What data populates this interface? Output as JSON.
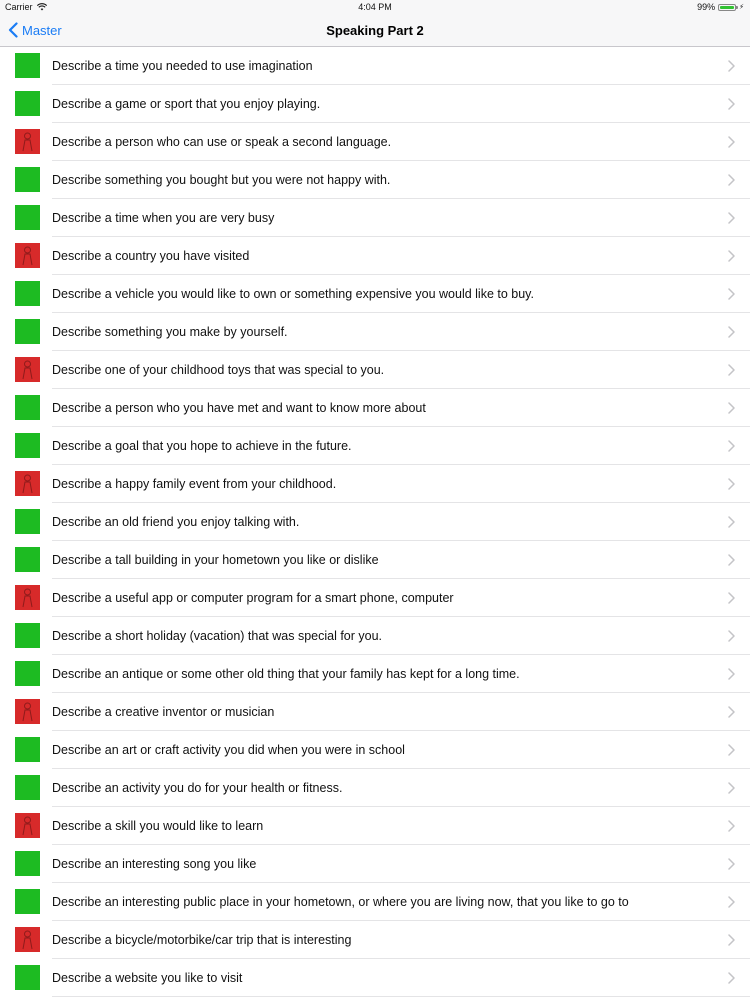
{
  "status_bar": {
    "carrier": "Carrier",
    "time": "4:04 PM",
    "battery_percent": "99%",
    "battery_level": 0.99,
    "battery_color": "#31c232"
  },
  "nav": {
    "back_label": "Master",
    "title": "Speaking Part 2",
    "tint_color": "#1a7cf5"
  },
  "topics": [
    {
      "label": "Describe a time you needed to use imagination",
      "thumb_color": "green"
    },
    {
      "label": "Describe a game or sport that you enjoy playing.",
      "thumb_color": "green"
    },
    {
      "label": "Describe a person who can use or speak a second language.",
      "thumb_color": "red"
    },
    {
      "label": "Describe something you bought but you were not happy with.",
      "thumb_color": "green"
    },
    {
      "label": "Describe a time when you are very busy",
      "thumb_color": "green"
    },
    {
      "label": "Describe a country you have visited",
      "thumb_color": "red"
    },
    {
      "label": "Describe a vehicle you would like to own or something expensive you would like to buy.",
      "thumb_color": "green"
    },
    {
      "label": "Describe something you make by yourself.",
      "thumb_color": "green"
    },
    {
      "label": "Describe one of your childhood toys that was special to you.",
      "thumb_color": "red"
    },
    {
      "label": "Describe a person who you have met and want to know more about",
      "thumb_color": "green"
    },
    {
      "label": "Describe a goal that you hope to achieve in the future.",
      "thumb_color": "green"
    },
    {
      "label": "Describe a happy family event from your childhood.",
      "thumb_color": "red"
    },
    {
      "label": "Describe an old friend you enjoy talking with.",
      "thumb_color": "green"
    },
    {
      "label": "Describe a tall building in your hometown you like or dislike",
      "thumb_color": "green"
    },
    {
      "label": "Describe a useful app or computer program for a smart phone, computer",
      "thumb_color": "red"
    },
    {
      "label": "Describe a short holiday (vacation) that was special for you.",
      "thumb_color": "green"
    },
    {
      "label": "Describe an antique or some other old thing that your family has kept for a long time.",
      "thumb_color": "green"
    },
    {
      "label": "Describe a creative inventor or musician",
      "thumb_color": "red"
    },
    {
      "label": "Describe an art or craft activity you did when you were in school",
      "thumb_color": "green"
    },
    {
      "label": "Describe an activity you do for your health or fitness.",
      "thumb_color": "green"
    },
    {
      "label": "Describe a skill you would like to learn",
      "thumb_color": "red"
    },
    {
      "label": "Describe an interesting song you like",
      "thumb_color": "green"
    },
    {
      "label": "Describe an interesting public place in your hometown, or where you are living now, that you like to go to",
      "thumb_color": "green"
    },
    {
      "label": "Describe a bicycle/motorbike/car trip that is interesting",
      "thumb_color": "red"
    },
    {
      "label": "Describe a website you like to visit",
      "thumb_color": "green"
    }
  ]
}
